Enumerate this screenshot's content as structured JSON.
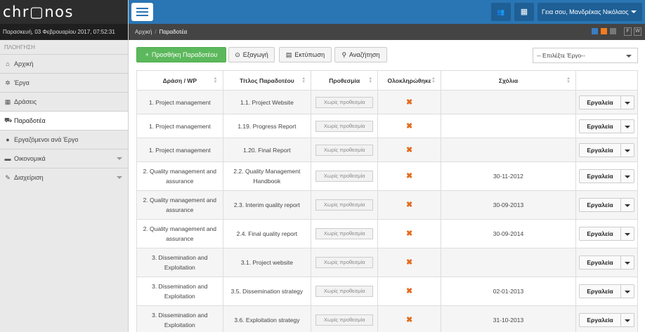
{
  "app": {
    "logo": "chr▢nos",
    "date": "Παρασκευή, 03 Φεβρουαρίου 2017, 07:52:31"
  },
  "sidebar": {
    "title": "ΠΛΟΗΓΗΣΗ",
    "items": [
      {
        "label": "Αρχική",
        "icon": "home-icon",
        "glyph": "⌂"
      },
      {
        "label": "Έργα",
        "icon": "gear-icon",
        "glyph": "✲"
      },
      {
        "label": "Δράσεις",
        "icon": "grid-icon",
        "glyph": "▦"
      },
      {
        "label": "Παραδοτέα",
        "icon": "cart-icon",
        "glyph": "⛟"
      },
      {
        "label": "Εργαζόμενοι ανά Έργο",
        "icon": "user-icon",
        "glyph": "●"
      },
      {
        "label": "Οικονομικά",
        "icon": "briefcase-icon",
        "glyph": "▬"
      },
      {
        "label": "Διαχείριση",
        "icon": "wrench-icon",
        "glyph": "✎"
      }
    ]
  },
  "header": {
    "user": "Γεια σου, Μανδρέκας Νικόλαος",
    "users_glyph": "👥",
    "calc_glyph": "▦"
  },
  "breadcrumb": {
    "home": "Αρχική",
    "sep": "/",
    "current": "Παραδοτέα",
    "box_f": "F",
    "box_w": "W",
    "colors": [
      "#3b7dc0",
      "#f47c20",
      "#777777"
    ]
  },
  "toolbar": {
    "add": "Προσθήκη Παραδοτέου",
    "export": "Εξαγωγή",
    "print": "Εκτύπωση",
    "search": "Αναζήτηση",
    "project_select": "-- Επιλέξτε Έργο--"
  },
  "table": {
    "headers": [
      "Δράση / WP",
      "Τίτλος Παραδοτέου",
      "Προθεσμία",
      "Ολοκληρώθηκε",
      "Σχόλια",
      ""
    ],
    "deadline_text": "Χωρίς προθεσμία",
    "tools_label": "Εργαλεία",
    "rows": [
      {
        "wp": [
          "1. Project management"
        ],
        "title": [
          "1.1. Project Website"
        ],
        "comment": ""
      },
      {
        "wp": [
          "1. Project management"
        ],
        "title": [
          "1.19. Progress Report"
        ],
        "comment": ""
      },
      {
        "wp": [
          "1. Project management"
        ],
        "title": [
          "1.20. Final Report"
        ],
        "comment": ""
      },
      {
        "wp": [
          "2. Quality management and",
          "assurance"
        ],
        "title": [
          "2.2. Quality Management",
          "Handbook"
        ],
        "comment": "30-11-2012"
      },
      {
        "wp": [
          "2. Quality management and",
          "assurance"
        ],
        "title": [
          "2.3. Interim quality report"
        ],
        "comment": "30-09-2013"
      },
      {
        "wp": [
          "2. Quality management and",
          "assurance"
        ],
        "title": [
          "2.4. Final quality report"
        ],
        "comment": "30-09-2014"
      },
      {
        "wp": [
          "3. Dissemination and",
          "Exploitation"
        ],
        "title": [
          "3.1. Project website"
        ],
        "comment": ""
      },
      {
        "wp": [
          "3. Dissemination and",
          "Exploitation"
        ],
        "title": [
          "3.5. Dissemination strategy"
        ],
        "comment": "02-01-2013"
      },
      {
        "wp": [
          "3. Dissemination and",
          "Exploitation"
        ],
        "title": [
          "3.6. Exploitation strategy"
        ],
        "comment": "31-10-2013"
      }
    ]
  }
}
